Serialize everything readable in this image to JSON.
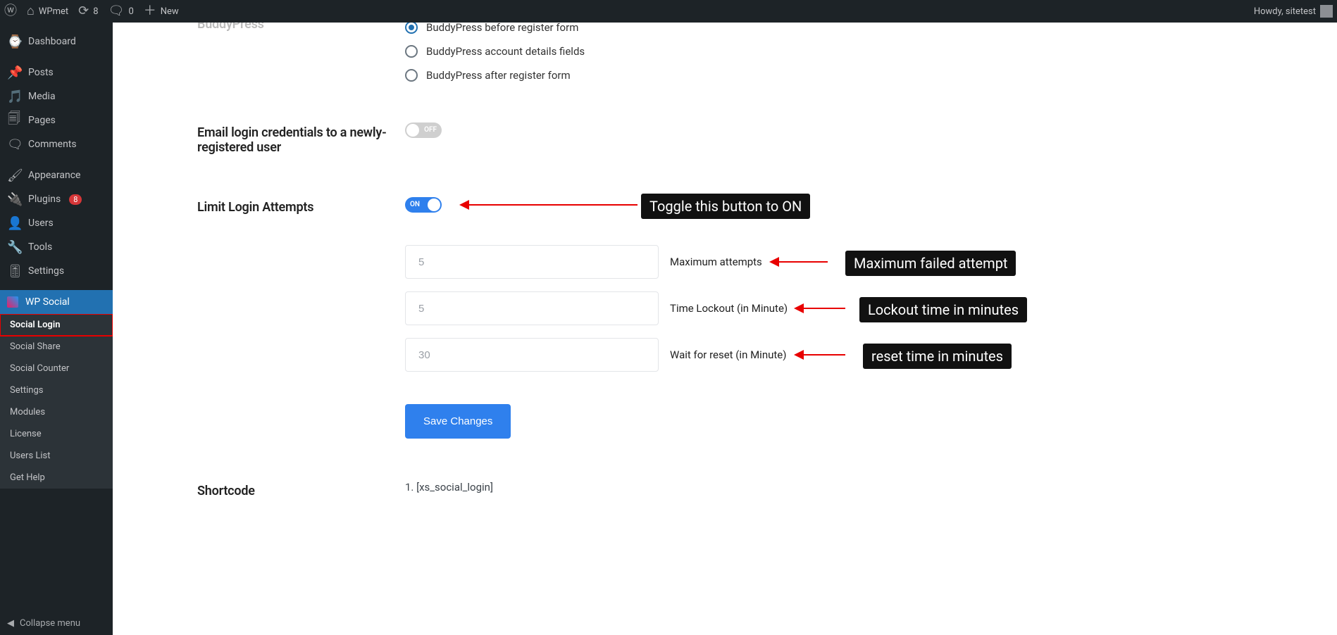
{
  "adminbar": {
    "site_name": "WPmet",
    "updates_count": "8",
    "comments_count": "0",
    "new_label": "New",
    "howdy": "Howdy, sitetest"
  },
  "adminmenu": {
    "dashboard": "Dashboard",
    "posts": "Posts",
    "media": "Media",
    "pages": "Pages",
    "comments": "Comments",
    "appearance": "Appearance",
    "plugins": "Plugins",
    "plugins_badge": "8",
    "users": "Users",
    "tools": "Tools",
    "settings": "Settings",
    "wpsocial": "WP Social",
    "submenu": {
      "social_login": "Social Login",
      "social_share": "Social Share",
      "social_counter": "Social Counter",
      "settings": "Settings",
      "modules": "Modules",
      "license": "License",
      "users_list": "Users List",
      "get_help": "Get Help"
    },
    "collapse": "Collapse menu"
  },
  "form": {
    "buddypress_label": "BuddyPress",
    "bp_before": "BuddyPress before register form",
    "bp_details": "BuddyPress account details fields",
    "bp_after": "BuddyPress after register form",
    "email_creds_label": "Email login credentials to a newly-registered user",
    "limit_label": "Limit Login Attempts",
    "on_text": "ON",
    "off_text": "OFF",
    "max_attempts_ph": "5",
    "max_attempts_label": "Maximum attempts",
    "lockout_ph": "5",
    "lockout_label": "Time Lockout (in Minute)",
    "wait_reset_ph": "30",
    "wait_reset_label": "Wait for reset (in Minute)",
    "save_btn": "Save Changes",
    "shortcode_label": "Shortcode",
    "shortcode_1": "1. [xs_social_login]"
  },
  "annotations": {
    "toggle_on": "Toggle this button to ON",
    "max_failed": "Maximum failed attempt",
    "lockout_time": "Lockout time in minutes",
    "reset_time": "reset time in minutes"
  }
}
